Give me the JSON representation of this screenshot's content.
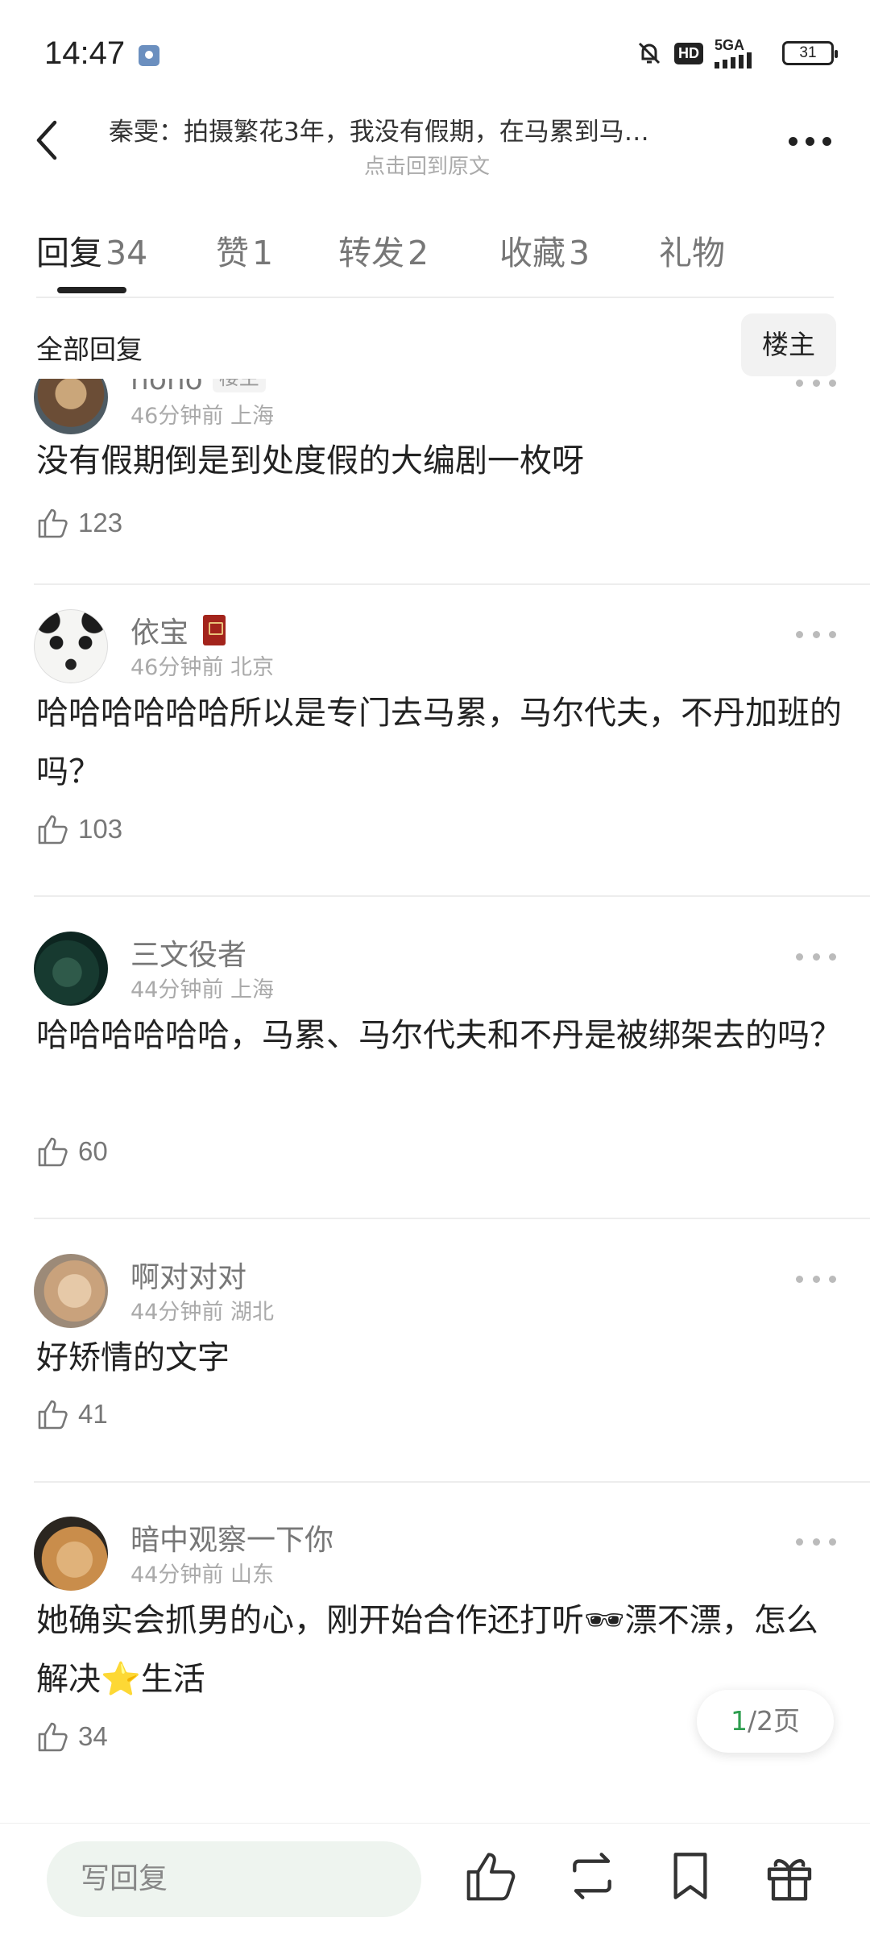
{
  "status_bar": {
    "time": "14:47",
    "network": "5GA",
    "hd": "HD",
    "battery": "31"
  },
  "header": {
    "title": "秦雯：拍摄繁花3年，我没有假期，在马累到马…",
    "subtitle": "点击回到原文"
  },
  "tabs": [
    {
      "label": "回复",
      "count": "34"
    },
    {
      "label": "赞",
      "count": "1"
    },
    {
      "label": "转发",
      "count": "2"
    },
    {
      "label": "收藏",
      "count": "3"
    },
    {
      "label": "礼物",
      "count": ""
    }
  ],
  "filter": {
    "all_label": "全部回复",
    "owner_button": "楼主"
  },
  "comments": [
    {
      "user": "nono",
      "badge": "楼主",
      "time": "46分钟前",
      "location": "上海",
      "text": "没有假期倒是到处度假的大编剧一枚呀",
      "likes": "123"
    },
    {
      "user": "依宝",
      "time": "46分钟前",
      "location": "北京",
      "text": "哈哈哈哈哈哈所以是专门去马累，马尔代夫，不丹加班的吗？",
      "likes": "103"
    },
    {
      "user": "三文役者",
      "time": "44分钟前",
      "location": "上海",
      "text": "哈哈哈哈哈哈，马累、马尔代夫和不丹是被绑架去的吗？",
      "likes": "60"
    },
    {
      "user": "啊对对对",
      "time": "44分钟前",
      "location": "湖北",
      "text": "好矫情的文字",
      "likes": "41"
    },
    {
      "user": "暗中观察一下你",
      "time": "44分钟前",
      "location": "山东",
      "text": "她确实会抓男的心，刚开始合作还打听🕶漂不漂，怎么解决⭐生活",
      "likes": "34"
    }
  ],
  "pager": {
    "current": "1",
    "total": "/2页"
  },
  "bottom_bar": {
    "reply_placeholder": "写回复"
  },
  "colors": {
    "accent_green": "#2e9e4f",
    "text_primary": "#222222",
    "text_secondary": "#777777"
  }
}
